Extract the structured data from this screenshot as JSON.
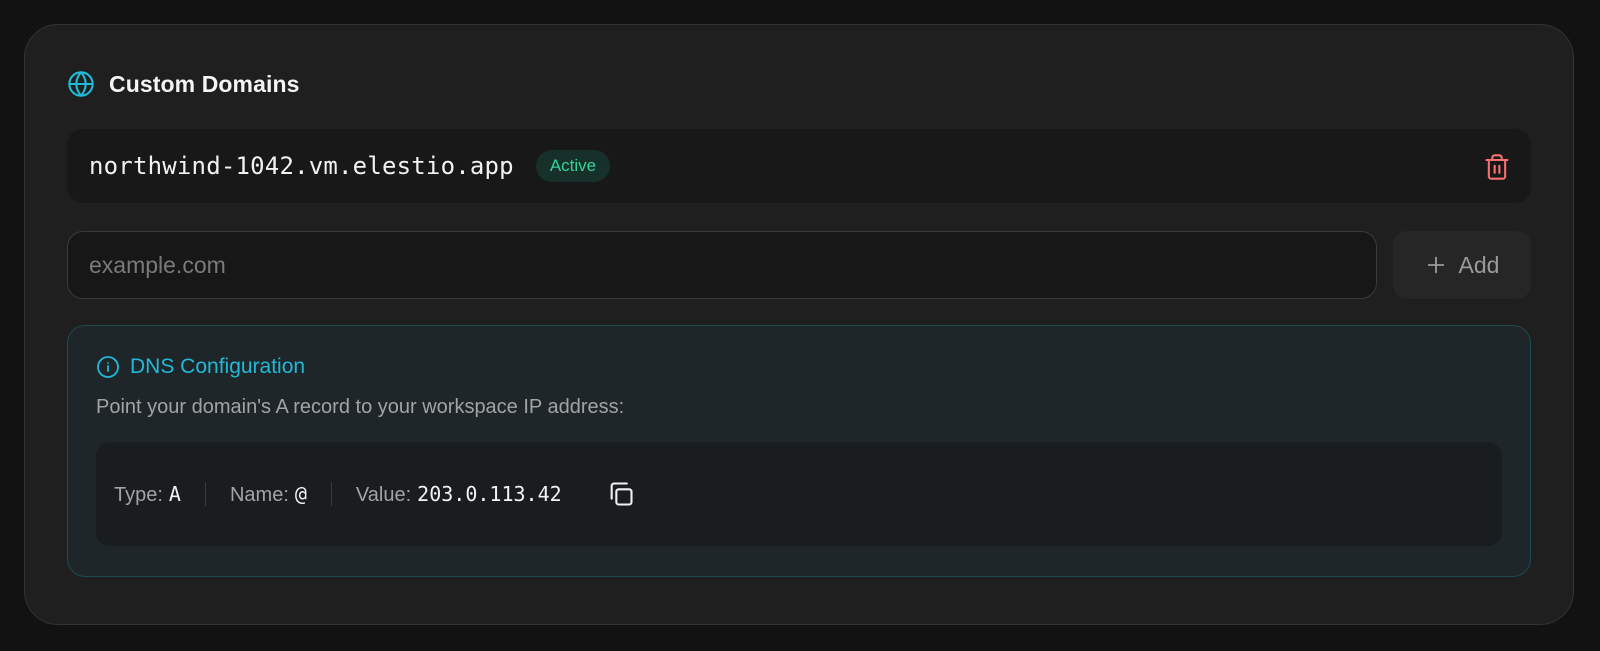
{
  "header": {
    "title": "Custom Domains",
    "icon": "globe-icon"
  },
  "domains": [
    {
      "name": "northwind-1042.vm.elestio.app",
      "status": "Active",
      "delete_icon": "trash-icon"
    }
  ],
  "add_domain": {
    "value": "",
    "placeholder": "example.com",
    "button_label": "Add",
    "button_icon": "plus-icon"
  },
  "dns": {
    "icon": "info-icon",
    "title": "DNS Configuration",
    "description": "Point your domain's A record to your workspace IP address:",
    "record": {
      "type_label": "Type:",
      "type_value": "A",
      "name_label": "Name:",
      "name_value": "@",
      "value_label": "Value:",
      "value_value": "203.0.113.42",
      "copy_icon": "copy-icon"
    }
  },
  "colors": {
    "background": "#121212",
    "card": "#1f1f1f",
    "accent": "#22b8d8",
    "status_active": "#34d399",
    "danger": "#f87171"
  }
}
